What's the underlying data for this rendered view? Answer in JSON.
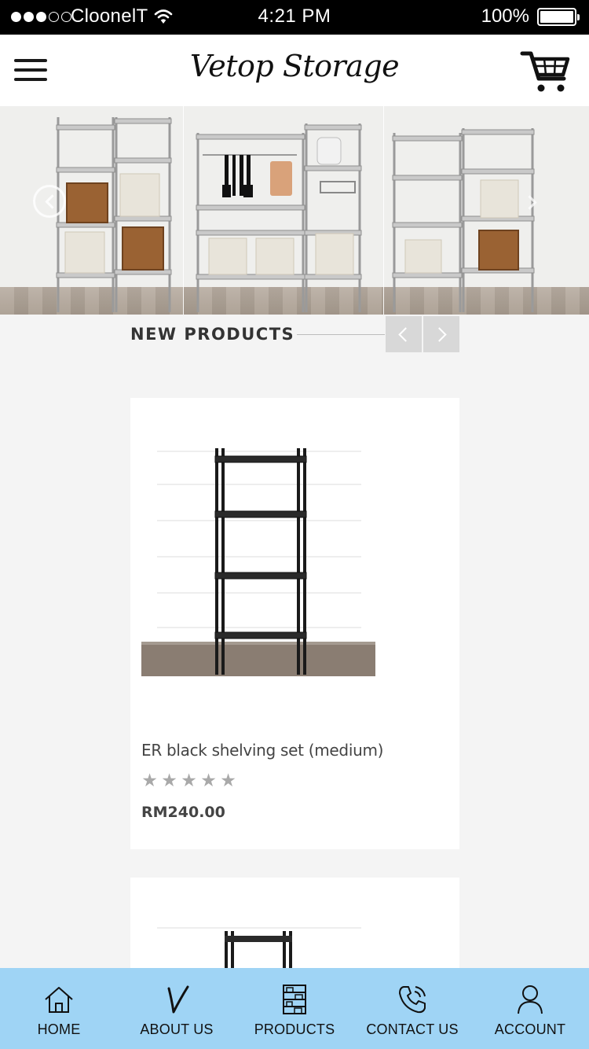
{
  "status_bar": {
    "carrier": "CloonelT",
    "time": "4:21 PM",
    "battery": "100%",
    "battery_level": 1.0,
    "signal_bars_filled": 3,
    "signal_bars_total": 5
  },
  "header": {
    "brand": "Vetop Storage",
    "menu_icon": "hamburger-menu-icon",
    "cart_icon": "shopping-cart-icon"
  },
  "banner": {
    "prev_icon": "chevron-left-circle-icon",
    "next_icon": "chevron-right-icon"
  },
  "section": {
    "title": "NEW PRODUCTS",
    "prev_icon": "chevron-left-icon",
    "next_icon": "chevron-right-icon"
  },
  "products": [
    {
      "name": "ER black shelving set (medium)",
      "rating": 0,
      "rating_max": 5,
      "price": "RM240.00"
    }
  ],
  "tab_bar": {
    "background": "#9fd4f5",
    "tabs": [
      {
        "label": "HOME",
        "icon": "home-icon"
      },
      {
        "label": "ABOUT US",
        "icon": "brand-v-icon"
      },
      {
        "label": "PRODUCTS",
        "icon": "shelf-icon"
      },
      {
        "label": "CONTACT US",
        "icon": "phone-icon"
      },
      {
        "label": "ACCOUNT",
        "icon": "user-icon"
      }
    ]
  }
}
